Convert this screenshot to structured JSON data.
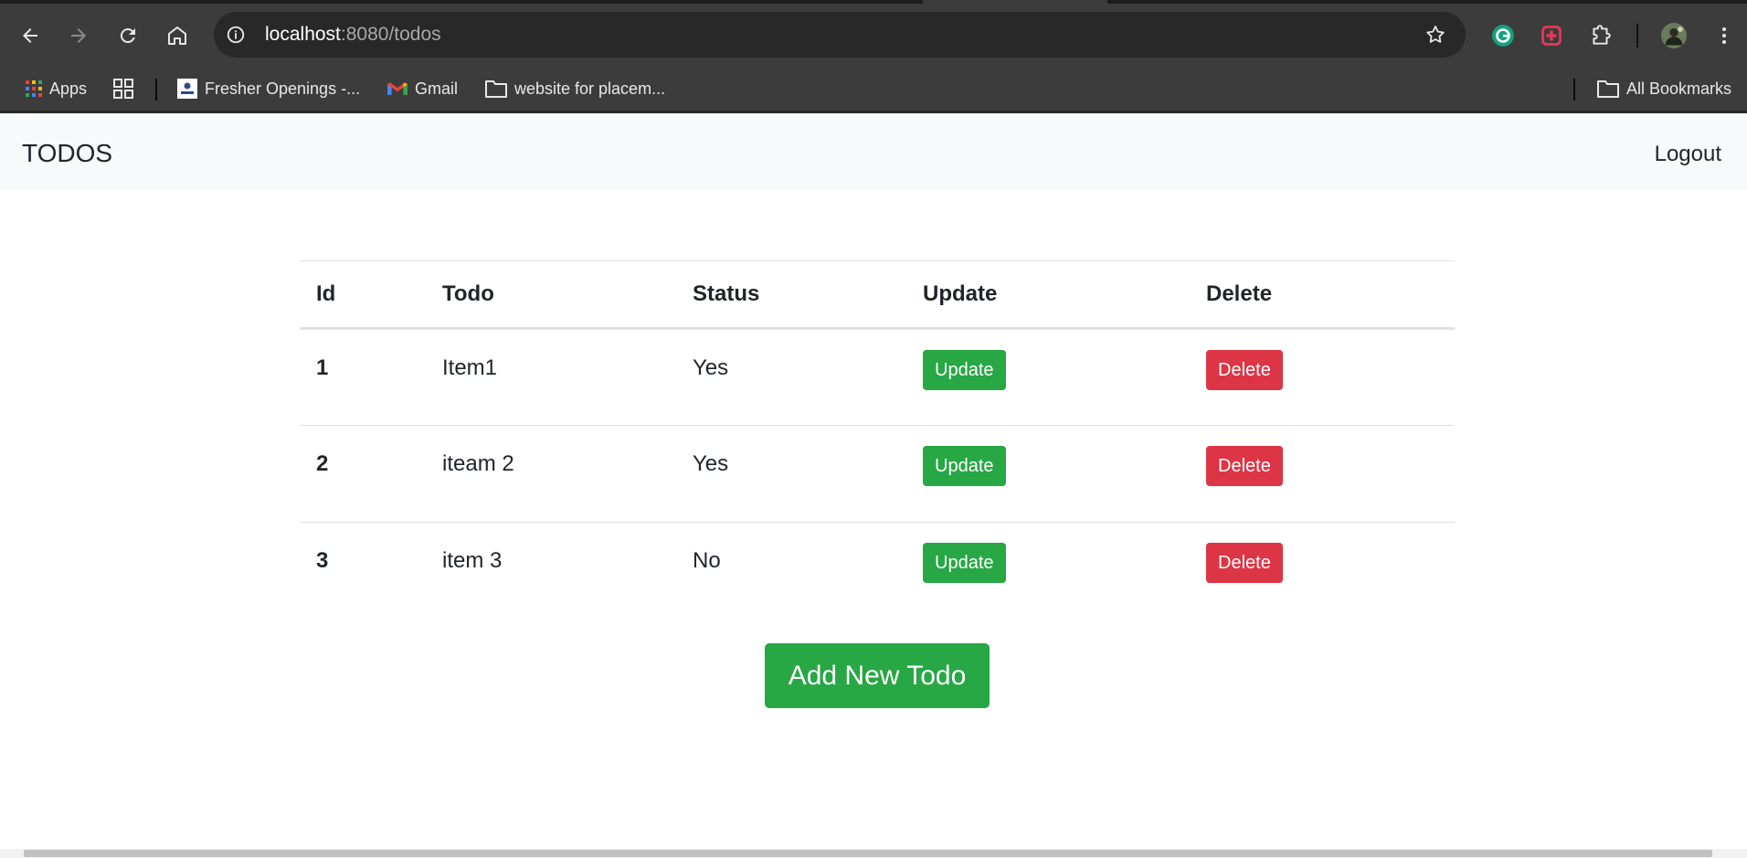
{
  "browser": {
    "url_host": "localhost",
    "url_path": ":8080/todos",
    "bookmarks": [
      {
        "label": "Apps",
        "icon": "apps-grid-icon"
      },
      {
        "label": "",
        "icon": "tab-groups-icon"
      },
      {
        "label": "Fresher Openings -...",
        "icon": "site-favicon"
      },
      {
        "label": "Gmail",
        "icon": "gmail-icon"
      },
      {
        "label": "website for placem...",
        "icon": "folder-icon"
      }
    ],
    "all_bookmarks_label": "All Bookmarks",
    "extensions": [
      "grammarly-icon",
      "extension-red-icon",
      "puzzle-icon",
      "profile-avatar",
      "kebab-menu-icon"
    ]
  },
  "navbar": {
    "brand": "TODOS",
    "logout": "Logout"
  },
  "table": {
    "headers": [
      "Id",
      "Todo",
      "Status",
      "Update",
      "Delete"
    ],
    "rows": [
      {
        "id": "1",
        "todo": "Item1",
        "status": "Yes",
        "update": "Update",
        "delete": "Delete"
      },
      {
        "id": "2",
        "todo": "iteam 2",
        "status": "Yes",
        "update": "Update",
        "delete": "Delete"
      },
      {
        "id": "3",
        "todo": "item 3",
        "status": "No",
        "update": "Update",
        "delete": "Delete"
      }
    ]
  },
  "add_button": "Add New Todo",
  "colors": {
    "success": "#28a745",
    "danger": "#dc3545",
    "navbar_bg": "#f8f9fa",
    "chrome_bg": "#3c3c3c"
  }
}
